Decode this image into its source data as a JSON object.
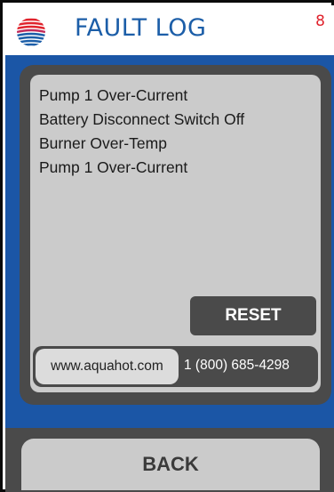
{
  "header": {
    "logo_icon": "aquahot-globe-icon",
    "title": "FAULT LOG",
    "fault_count": "8"
  },
  "faults": [
    "Pump 1 Over-Current",
    "Battery Disconnect Switch Off",
    "Burner Over-Temp",
    "Pump 1 Over-Current"
  ],
  "buttons": {
    "reset_label": "RESET",
    "back_label": "BACK"
  },
  "contact": {
    "website": "www.aquahot.com",
    "phone": "1 (800) 685-4298"
  },
  "colors": {
    "title": "#1c5ea8",
    "count": "#e0232d",
    "main_bg": "#1b56a6",
    "panel_dark": "#4a4a4a",
    "panel_light": "#cbcbcb"
  }
}
